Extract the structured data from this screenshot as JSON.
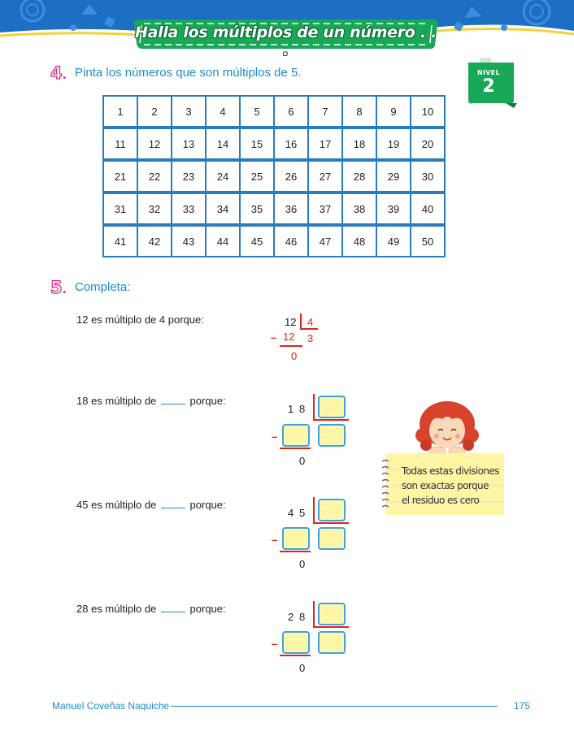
{
  "header": {
    "title": "Halla los múltiplos de un número . . .",
    "nivel_label": "NIVEL",
    "nivel_number": "2"
  },
  "exercise4": {
    "number": "4",
    "instruction": "Pinta los números que son múltiplos de 5.",
    "rows": [
      [
        "1",
        "2",
        "3",
        "4",
        "5",
        "6",
        "7",
        "8",
        "9",
        "10"
      ],
      [
        "11",
        "12",
        "13",
        "14",
        "15",
        "16",
        "17",
        "18",
        "19",
        "20"
      ],
      [
        "21",
        "22",
        "23",
        "24",
        "25",
        "26",
        "27",
        "28",
        "29",
        "30"
      ],
      [
        "31",
        "32",
        "33",
        "34",
        "35",
        "36",
        "37",
        "38",
        "39",
        "40"
      ],
      [
        "41",
        "42",
        "43",
        "44",
        "45",
        "46",
        "47",
        "48",
        "49",
        "50"
      ]
    ]
  },
  "exercise5": {
    "number": "5",
    "instruction": "Completa:",
    "example": {
      "statement": "12 es múltiplo de 4 porque:",
      "dividend": "12",
      "divisor": "4",
      "subtrahend": "12",
      "quotient": "3",
      "minus": "–",
      "remainder": "0"
    },
    "items": [
      {
        "statement_start": "18 es múltiplo de",
        "statement_end": "porque:",
        "dividend_a": "1",
        "dividend_b": "8",
        "minus": "–",
        "remainder": "0"
      },
      {
        "statement_start": "45 es múltiplo de",
        "statement_end": "porque:",
        "dividend_a": "4",
        "dividend_b": "5",
        "minus": "–",
        "remainder": "0"
      },
      {
        "statement_start": "28 es múltiplo de",
        "statement_end": "porque:",
        "dividend_a": "2",
        "dividend_b": "8",
        "minus": "–",
        "remainder": "0"
      }
    ]
  },
  "note": {
    "lines": [
      "Todas estas divisiones",
      "son exactas  porque",
      "el residuo es cero"
    ]
  },
  "footer": {
    "author": "Manuel Coveñas Naquiche",
    "page": "175"
  }
}
